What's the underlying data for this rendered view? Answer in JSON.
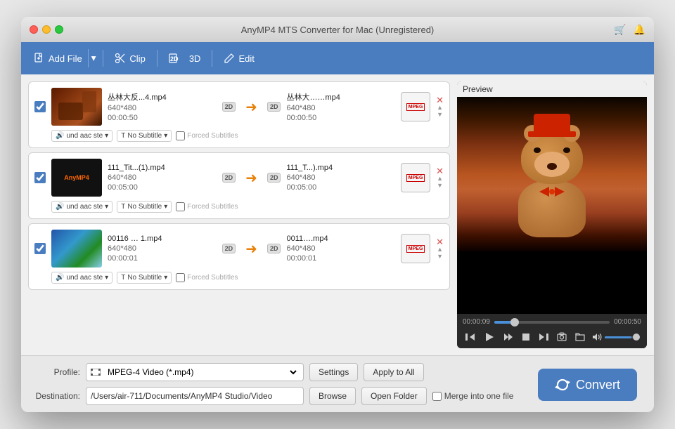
{
  "window": {
    "title": "AnyMP4 MTS Converter for Mac (Unregistered)"
  },
  "toolbar": {
    "add_file": "Add File",
    "clip": "Clip",
    "three_d": "3D",
    "edit": "Edit"
  },
  "files": [
    {
      "id": 1,
      "input_name": "丛林大反...4.mp4",
      "input_resolution": "640*480",
      "input_duration": "00:00:50",
      "output_name": "丛林大……mp4",
      "output_resolution": "640*480",
      "output_duration": "00:00:50",
      "audio": "und aac ste",
      "subtitle": "No Subtitle",
      "has_thumb": true,
      "thumb_type": "1"
    },
    {
      "id": 2,
      "input_name": "111_Tit...(1).mp4",
      "input_resolution": "640*480",
      "input_duration": "00:05:00",
      "output_name": "111_T...).mp4",
      "output_resolution": "640*480",
      "output_duration": "00:05:00",
      "audio": "und aac ste",
      "subtitle": "No Subtitle",
      "has_thumb": false,
      "thumb_type": "2"
    },
    {
      "id": 3,
      "input_name": "00116 … 1.mp4",
      "input_resolution": "640*480",
      "input_duration": "00:00:01",
      "output_name": "0011….mp4",
      "output_resolution": "640*480",
      "output_duration": "00:00:01",
      "audio": "und aac ste",
      "subtitle": "No Subtitle",
      "has_thumb": true,
      "thumb_type": "3"
    }
  ],
  "preview": {
    "label": "Preview",
    "time_current": "00:00:09",
    "time_total": "00:00:50",
    "progress_percent": 18
  },
  "bottom": {
    "profile_label": "Profile:",
    "profile_value": "MPEG-4 Video (*.mp4)",
    "settings_btn": "Settings",
    "apply_to_all_btn": "Apply to All",
    "destination_label": "Destination:",
    "destination_value": "/Users/air-711/Documents/AnyMP4 Studio/Video",
    "browse_btn": "Browse",
    "open_folder_btn": "Open Folder",
    "merge_label": "Merge into one file",
    "convert_btn": "Convert"
  }
}
